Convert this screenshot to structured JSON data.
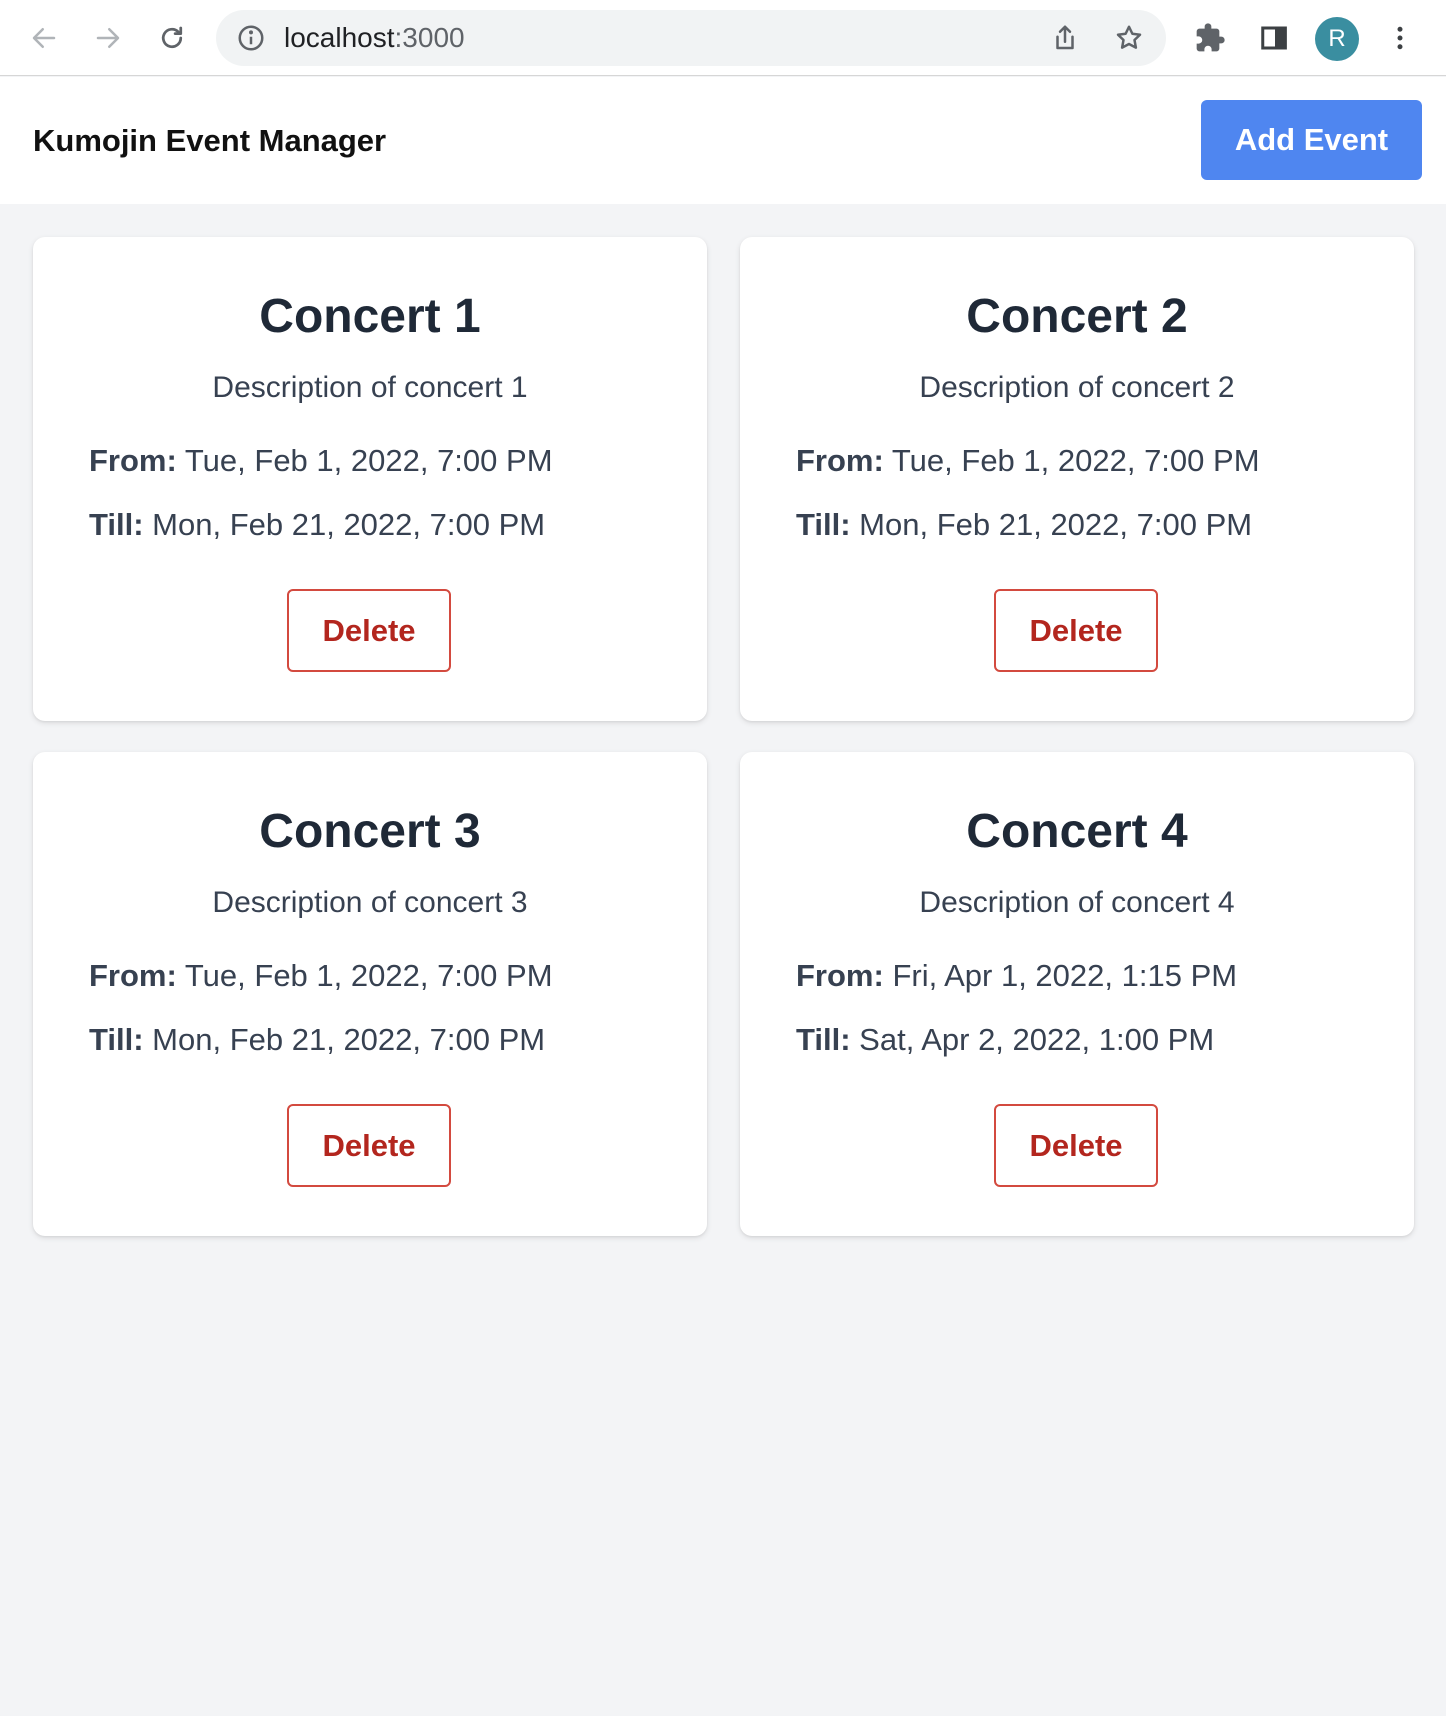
{
  "browser": {
    "url_host": "localhost",
    "url_port": ":3000",
    "profile_initial": "R",
    "avatar_color": "#3a8ea0"
  },
  "app": {
    "title": "Kumojin Event Manager",
    "add_event_label": "Add Event",
    "accent_color": "#4f86f0",
    "delete_color": "#b3261e"
  },
  "labels": {
    "from": "From:",
    "till": "Till:"
  },
  "events": [
    {
      "title": "Concert 1",
      "description": "Description of concert 1",
      "from": "Tue, Feb 1, 2022, 7:00 PM",
      "till": "Mon, Feb 21, 2022, 7:00 PM",
      "delete_label": "Delete"
    },
    {
      "title": "Concert 2",
      "description": "Description of concert 2",
      "from": "Tue, Feb 1, 2022, 7:00 PM",
      "till": "Mon, Feb 21, 2022, 7:00 PM",
      "delete_label": "Delete"
    },
    {
      "title": "Concert 3",
      "description": "Description of concert 3",
      "from": "Tue, Feb 1, 2022, 7:00 PM",
      "till": "Mon, Feb 21, 2022, 7:00 PM",
      "delete_label": "Delete"
    },
    {
      "title": "Concert 4",
      "description": "Description of concert 4",
      "from": "Fri, Apr 1, 2022, 1:15 PM",
      "till": "Sat, Apr 2, 2022, 1:00 PM",
      "delete_label": "Delete"
    }
  ]
}
